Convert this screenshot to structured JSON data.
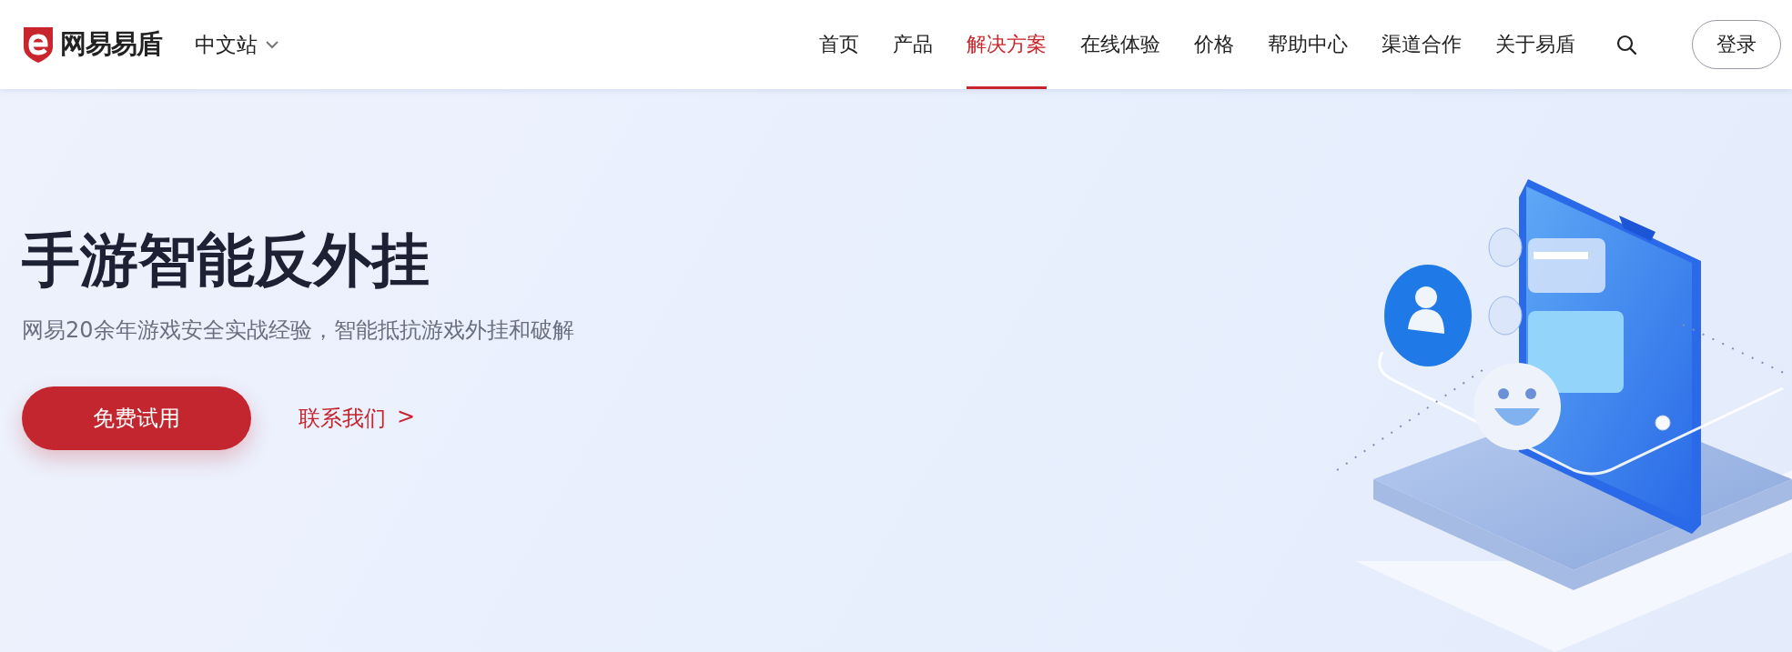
{
  "header": {
    "logo_text": "网易易盾",
    "language": "中文站",
    "nav": [
      {
        "label": "首页",
        "selected": false
      },
      {
        "label": "产品",
        "selected": false
      },
      {
        "label": "解决方案",
        "selected": true
      },
      {
        "label": "在线体验",
        "selected": false
      },
      {
        "label": "价格",
        "selected": false
      },
      {
        "label": "帮助中心",
        "selected": false
      },
      {
        "label": "渠道合作",
        "selected": false
      },
      {
        "label": "关于易盾",
        "selected": false
      }
    ],
    "login": "登录"
  },
  "hero": {
    "title": "手游智能反外挂",
    "subtitle": "网易20余年游戏安全实战经验，智能抵抗游戏外挂和破解",
    "primary_button": "免费试用",
    "secondary_link": "联系我们",
    "secondary_link_arrow": ">"
  }
}
